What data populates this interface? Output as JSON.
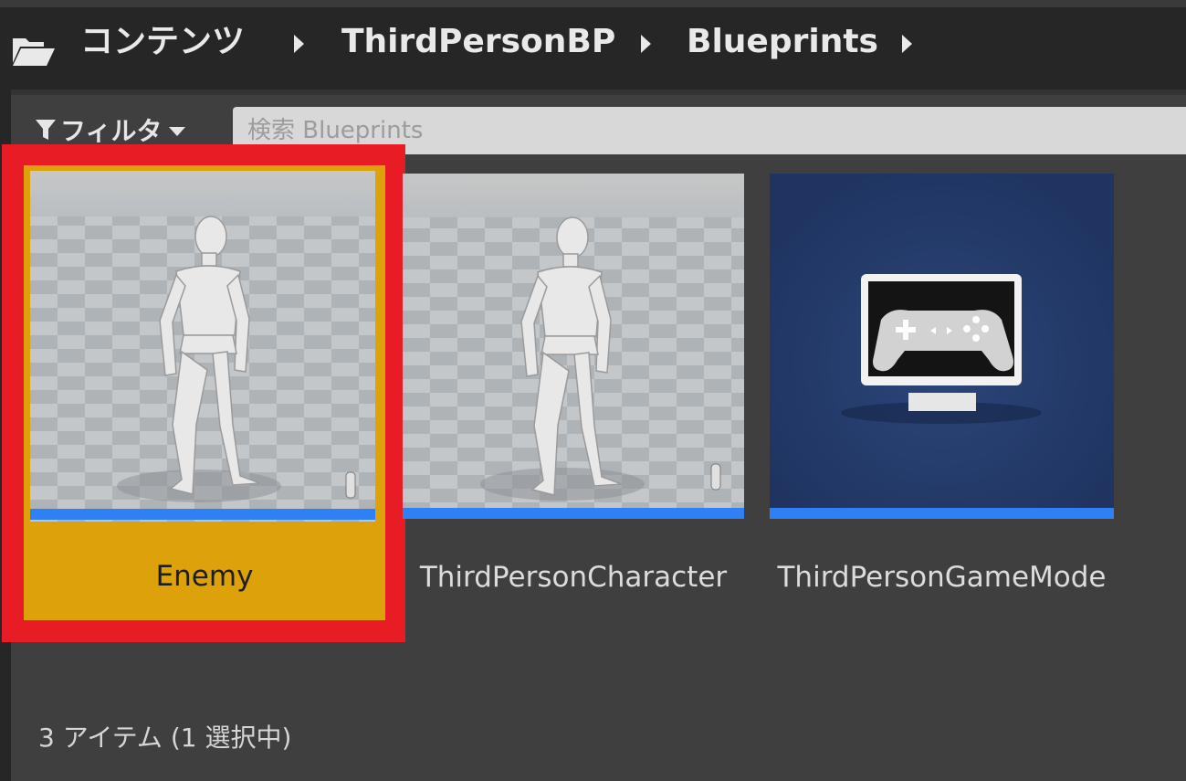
{
  "breadcrumb": {
    "items": [
      "コンテンツ",
      "ThirdPersonBP",
      "Blueprints"
    ]
  },
  "toolbar": {
    "filter_label": "フィルタ",
    "search_placeholder": "検索 Blueprints"
  },
  "assets": [
    {
      "name": "Enemy",
      "type": "character-blueprint",
      "selected": true
    },
    {
      "name": "ThirdPersonCharacter",
      "type": "character-blueprint",
      "selected": false
    },
    {
      "name": "ThirdPersonGameMode",
      "type": "gamemode-blueprint",
      "selected": false
    }
  ],
  "status": {
    "text": "3 アイテム (1 選択中)"
  },
  "colors": {
    "selection_highlight": "#dda20a",
    "annotation_outline": "#e81c24",
    "asset_type_bar": "#2f7ff5",
    "gamemode_background": "#233a68"
  },
  "icons": [
    "folder-open-icon",
    "chevron-right-icon",
    "filter-icon",
    "chevron-down-icon",
    "mannequin-icon",
    "gamepad-monitor-icon"
  ]
}
